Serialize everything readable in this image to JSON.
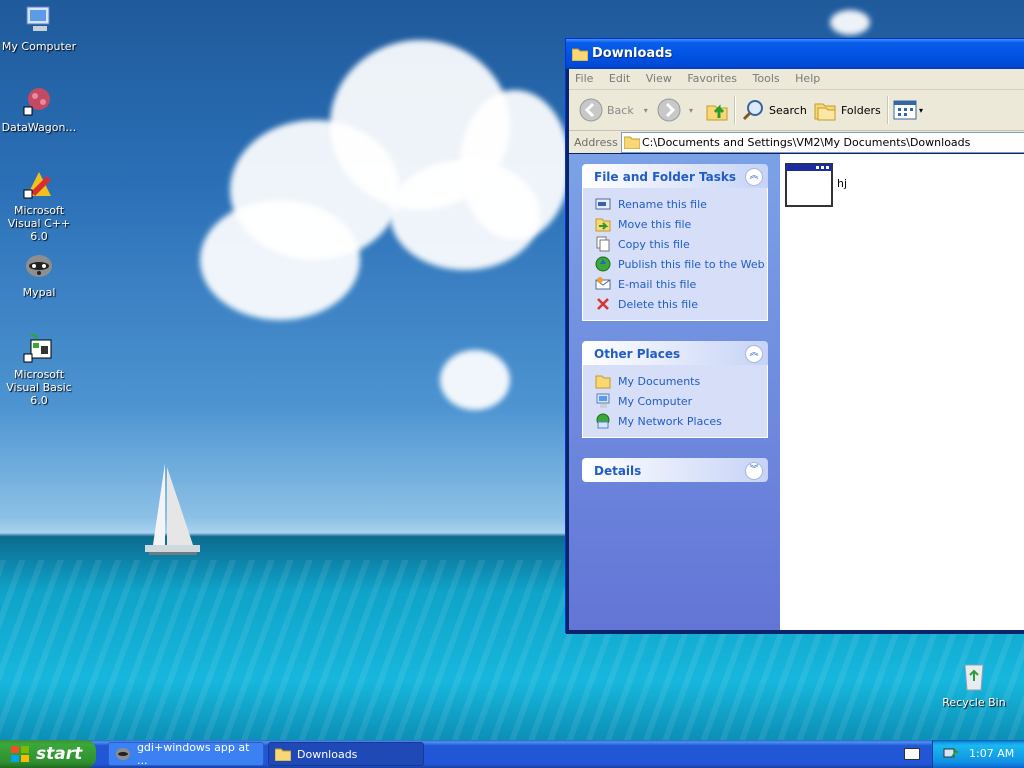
{
  "desktop": {
    "icons": [
      {
        "label": "My Computer"
      },
      {
        "label": "DataWagon…"
      },
      {
        "label": "Microsoft Visual C++ 6.0"
      },
      {
        "label": "Mypal"
      },
      {
        "label": "Microsoft Visual Basic 6.0"
      },
      {
        "label": "Recycle Bin"
      }
    ]
  },
  "window": {
    "title": "Downloads",
    "menu": [
      "File",
      "Edit",
      "View",
      "Favorites",
      "Tools",
      "Help"
    ],
    "toolbar": {
      "back": "Back",
      "search": "Search",
      "folders": "Folders"
    },
    "address": {
      "label": "Address",
      "value": "C:\\Documents and Settings\\VM2\\My Documents\\Downloads"
    },
    "panels": {
      "file_tasks": {
        "title": "File and Folder Tasks",
        "items": [
          "Rename this file",
          "Move this file",
          "Copy this file",
          "Publish this file to the Web",
          "E-mail this file",
          "Delete this file"
        ]
      },
      "other_places": {
        "title": "Other Places",
        "items": [
          "My Documents",
          "My Computer",
          "My Network Places"
        ]
      },
      "details": {
        "title": "Details"
      }
    },
    "files": [
      {
        "name": "hj"
      }
    ]
  },
  "taskbar": {
    "start": "start",
    "buttons": [
      "gdi+windows app at ...",
      "Downloads"
    ],
    "clock": "1:07 AM"
  }
}
